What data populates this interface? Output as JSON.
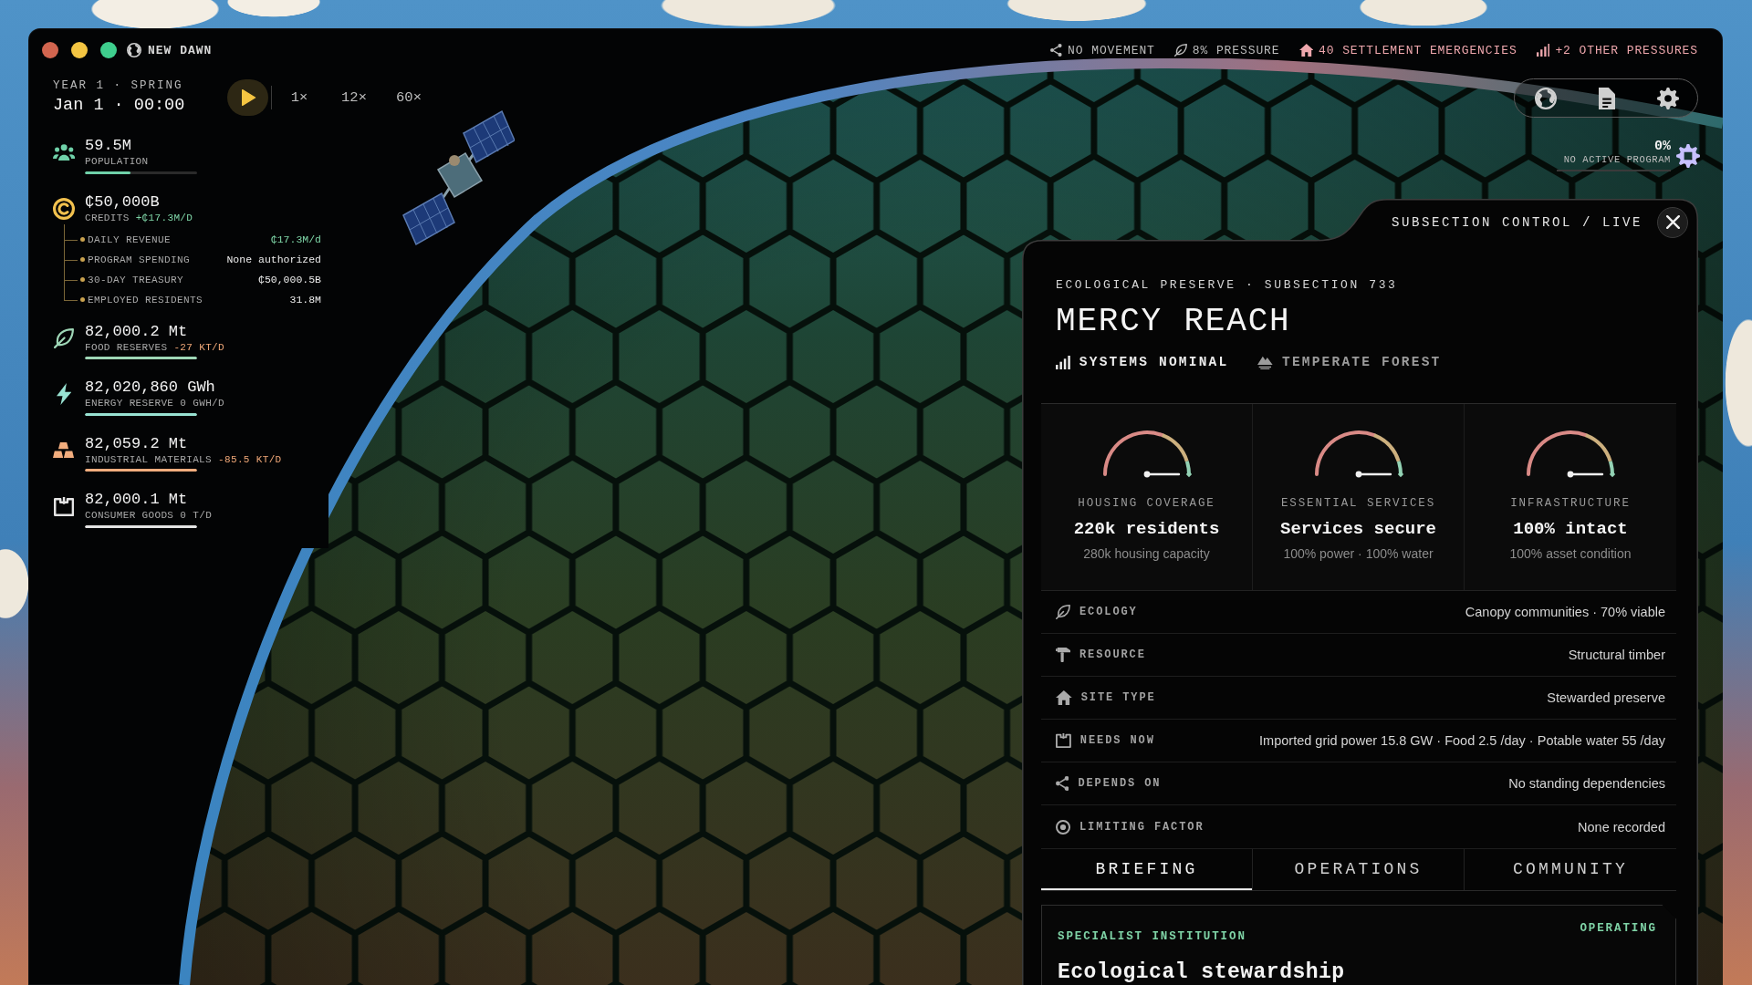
{
  "window": {
    "title": "NEW DAWN"
  },
  "status_bar": [
    {
      "kind": "movement",
      "label": "NO MOVEMENT",
      "alert": false
    },
    {
      "kind": "ecology",
      "label": "8% PRESSURE",
      "alert": false
    },
    {
      "kind": "settlement",
      "label": "40 SETTLEMENT EMERGENCIES",
      "alert": true
    },
    {
      "kind": "pressures",
      "label": "+2 OTHER PRESSURES",
      "alert": true
    }
  ],
  "clock": {
    "season": "YEAR 1 · SPRING",
    "time": "Jan 1 · 00:00",
    "playing": false,
    "speeds": [
      "1×",
      "12×",
      "60×"
    ]
  },
  "stats": [
    {
      "kind": "population",
      "value": "59.5M",
      "label": "POPULATION",
      "level": 0.41,
      "color": "#6fd1a9"
    },
    {
      "kind": "credits",
      "value": "₵50,000B",
      "label": "CREDITS",
      "change": {
        "text": "+₵17.3M/D",
        "kind": "gain"
      },
      "color": "#f2c14e",
      "breakdown": [
        {
          "label": "DAILY REVENUE",
          "value": "₵17.3M/d",
          "positive": true
        },
        {
          "label": "PROGRAM SPENDING",
          "value": "None authorized",
          "positive": false
        },
        {
          "label": "30-DAY TREASURY",
          "value": "₵50,000.5B",
          "positive": false
        },
        {
          "label": "EMPLOYED RESIDENTS",
          "value": "31.8M",
          "positive": false
        }
      ]
    },
    {
      "kind": "food",
      "value": "82,000.2 Mt",
      "label": "FOOD RESERVES",
      "change": {
        "text": "-27 KT/D",
        "kind": "loss"
      },
      "level": 1,
      "color": "#9ed6b6"
    },
    {
      "kind": "energy",
      "value": "82,020,860 GWh",
      "label": "ENERGY RESERVE",
      "change": {
        "text": "0 GWH/D",
        "kind": "flat"
      },
      "level": 1,
      "color": "#98e2d2"
    },
    {
      "kind": "materials",
      "value": "82,059.2 Mt",
      "label": "INDUSTRIAL MATERIALS",
      "change": {
        "text": "-85.5 KT/D",
        "kind": "loss"
      },
      "level": 1,
      "color": "#f2ad7e"
    },
    {
      "kind": "goods",
      "value": "82,000.1 Mt",
      "label": "CONSUMER GOODS",
      "change": {
        "text": "0 T/D",
        "kind": "flat"
      },
      "level": 1,
      "color": "#e4e4e4"
    }
  ],
  "program": {
    "percent": "0%",
    "label": "NO ACTIVE PROGRAM",
    "level": 0
  },
  "panel": {
    "header": "SUBSECTION CONTROL / LIVE",
    "category": "ECOLOGICAL PRESERVE · SUBSECTION 733",
    "name": "MERCY REACH",
    "tags": [
      {
        "kind": "status",
        "label": "SYSTEMS NOMINAL"
      },
      {
        "kind": "biome",
        "label": "TEMPERATE FOREST"
      }
    ],
    "gauges": [
      {
        "label": "HOUSING COVERAGE",
        "value": "220k residents",
        "detail": "280k housing capacity",
        "level": 1
      },
      {
        "label": "ESSENTIAL SERVICES",
        "value": "Services secure",
        "detail": "100% power · 100% water",
        "level": 1
      },
      {
        "label": "INFRASTRUCTURE",
        "value": "100% intact",
        "detail": "100% asset condition",
        "level": 1
      }
    ],
    "details": [
      {
        "kind": "ecology",
        "label": "ECOLOGY",
        "value": "Canopy communities · 70% viable"
      },
      {
        "kind": "resource",
        "label": "RESOURCE",
        "value": "Structural timber"
      },
      {
        "kind": "site",
        "label": "SITE TYPE",
        "value": "Stewarded preserve"
      },
      {
        "kind": "needs",
        "label": "NEEDS NOW",
        "value": "Imported grid power 15.8 GW · Food 2.5 /day · Potable water 55 /day"
      },
      {
        "kind": "dependencies",
        "label": "DEPENDS ON",
        "value": "No standing dependencies"
      },
      {
        "kind": "limits",
        "label": "LIMITING FACTOR",
        "value": "None recorded"
      }
    ],
    "tabs": [
      {
        "label": "BRIEFING",
        "selected": true
      },
      {
        "label": "OPERATIONS",
        "selected": false
      },
      {
        "label": "COMMUNITY",
        "selected": false
      }
    ],
    "card": {
      "eyebrow": "SPECIALIST INSTITUTION",
      "status": "OPERATING",
      "title": "Ecological stewardship"
    }
  }
}
